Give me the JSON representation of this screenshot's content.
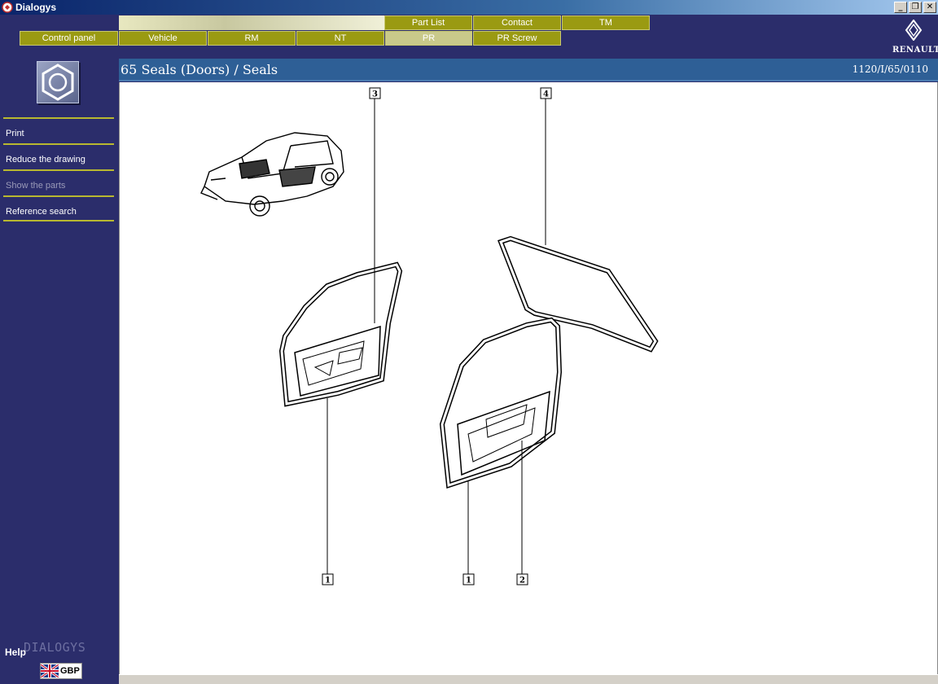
{
  "window": {
    "title": "Dialogys",
    "controls": [
      "_",
      "❐",
      "✕"
    ]
  },
  "tabs_top": [
    {
      "label": "Part List"
    },
    {
      "label": "Contact"
    },
    {
      "label": "TM"
    }
  ],
  "tabs_bottom": [
    {
      "label": "Control panel"
    },
    {
      "label": "Vehicle"
    },
    {
      "label": "RM"
    },
    {
      "label": "NT"
    },
    {
      "label": "PR",
      "active": true
    },
    {
      "label": "PR Screw"
    }
  ],
  "brand": {
    "name": "RENAULT"
  },
  "sidebar": {
    "menu": [
      {
        "label": "Print"
      },
      {
        "label": "Reduce the drawing"
      },
      {
        "label": "Show the parts",
        "disabled": true
      },
      {
        "label": "Reference search"
      }
    ],
    "help_label": "Help",
    "product_mark": "DIALOGYS",
    "language": "GBP"
  },
  "page": {
    "title": "65 Seals (Doors) / Seals",
    "reference": "1120/I/65/0110"
  },
  "drawing": {
    "callouts": [
      "3",
      "4",
      "1",
      "1",
      "2"
    ]
  },
  "colors": {
    "background": "#2b2d6b",
    "tab": "#9a9a12",
    "title_strip": "#2e5f96",
    "menu_rule": "#b8b830"
  }
}
